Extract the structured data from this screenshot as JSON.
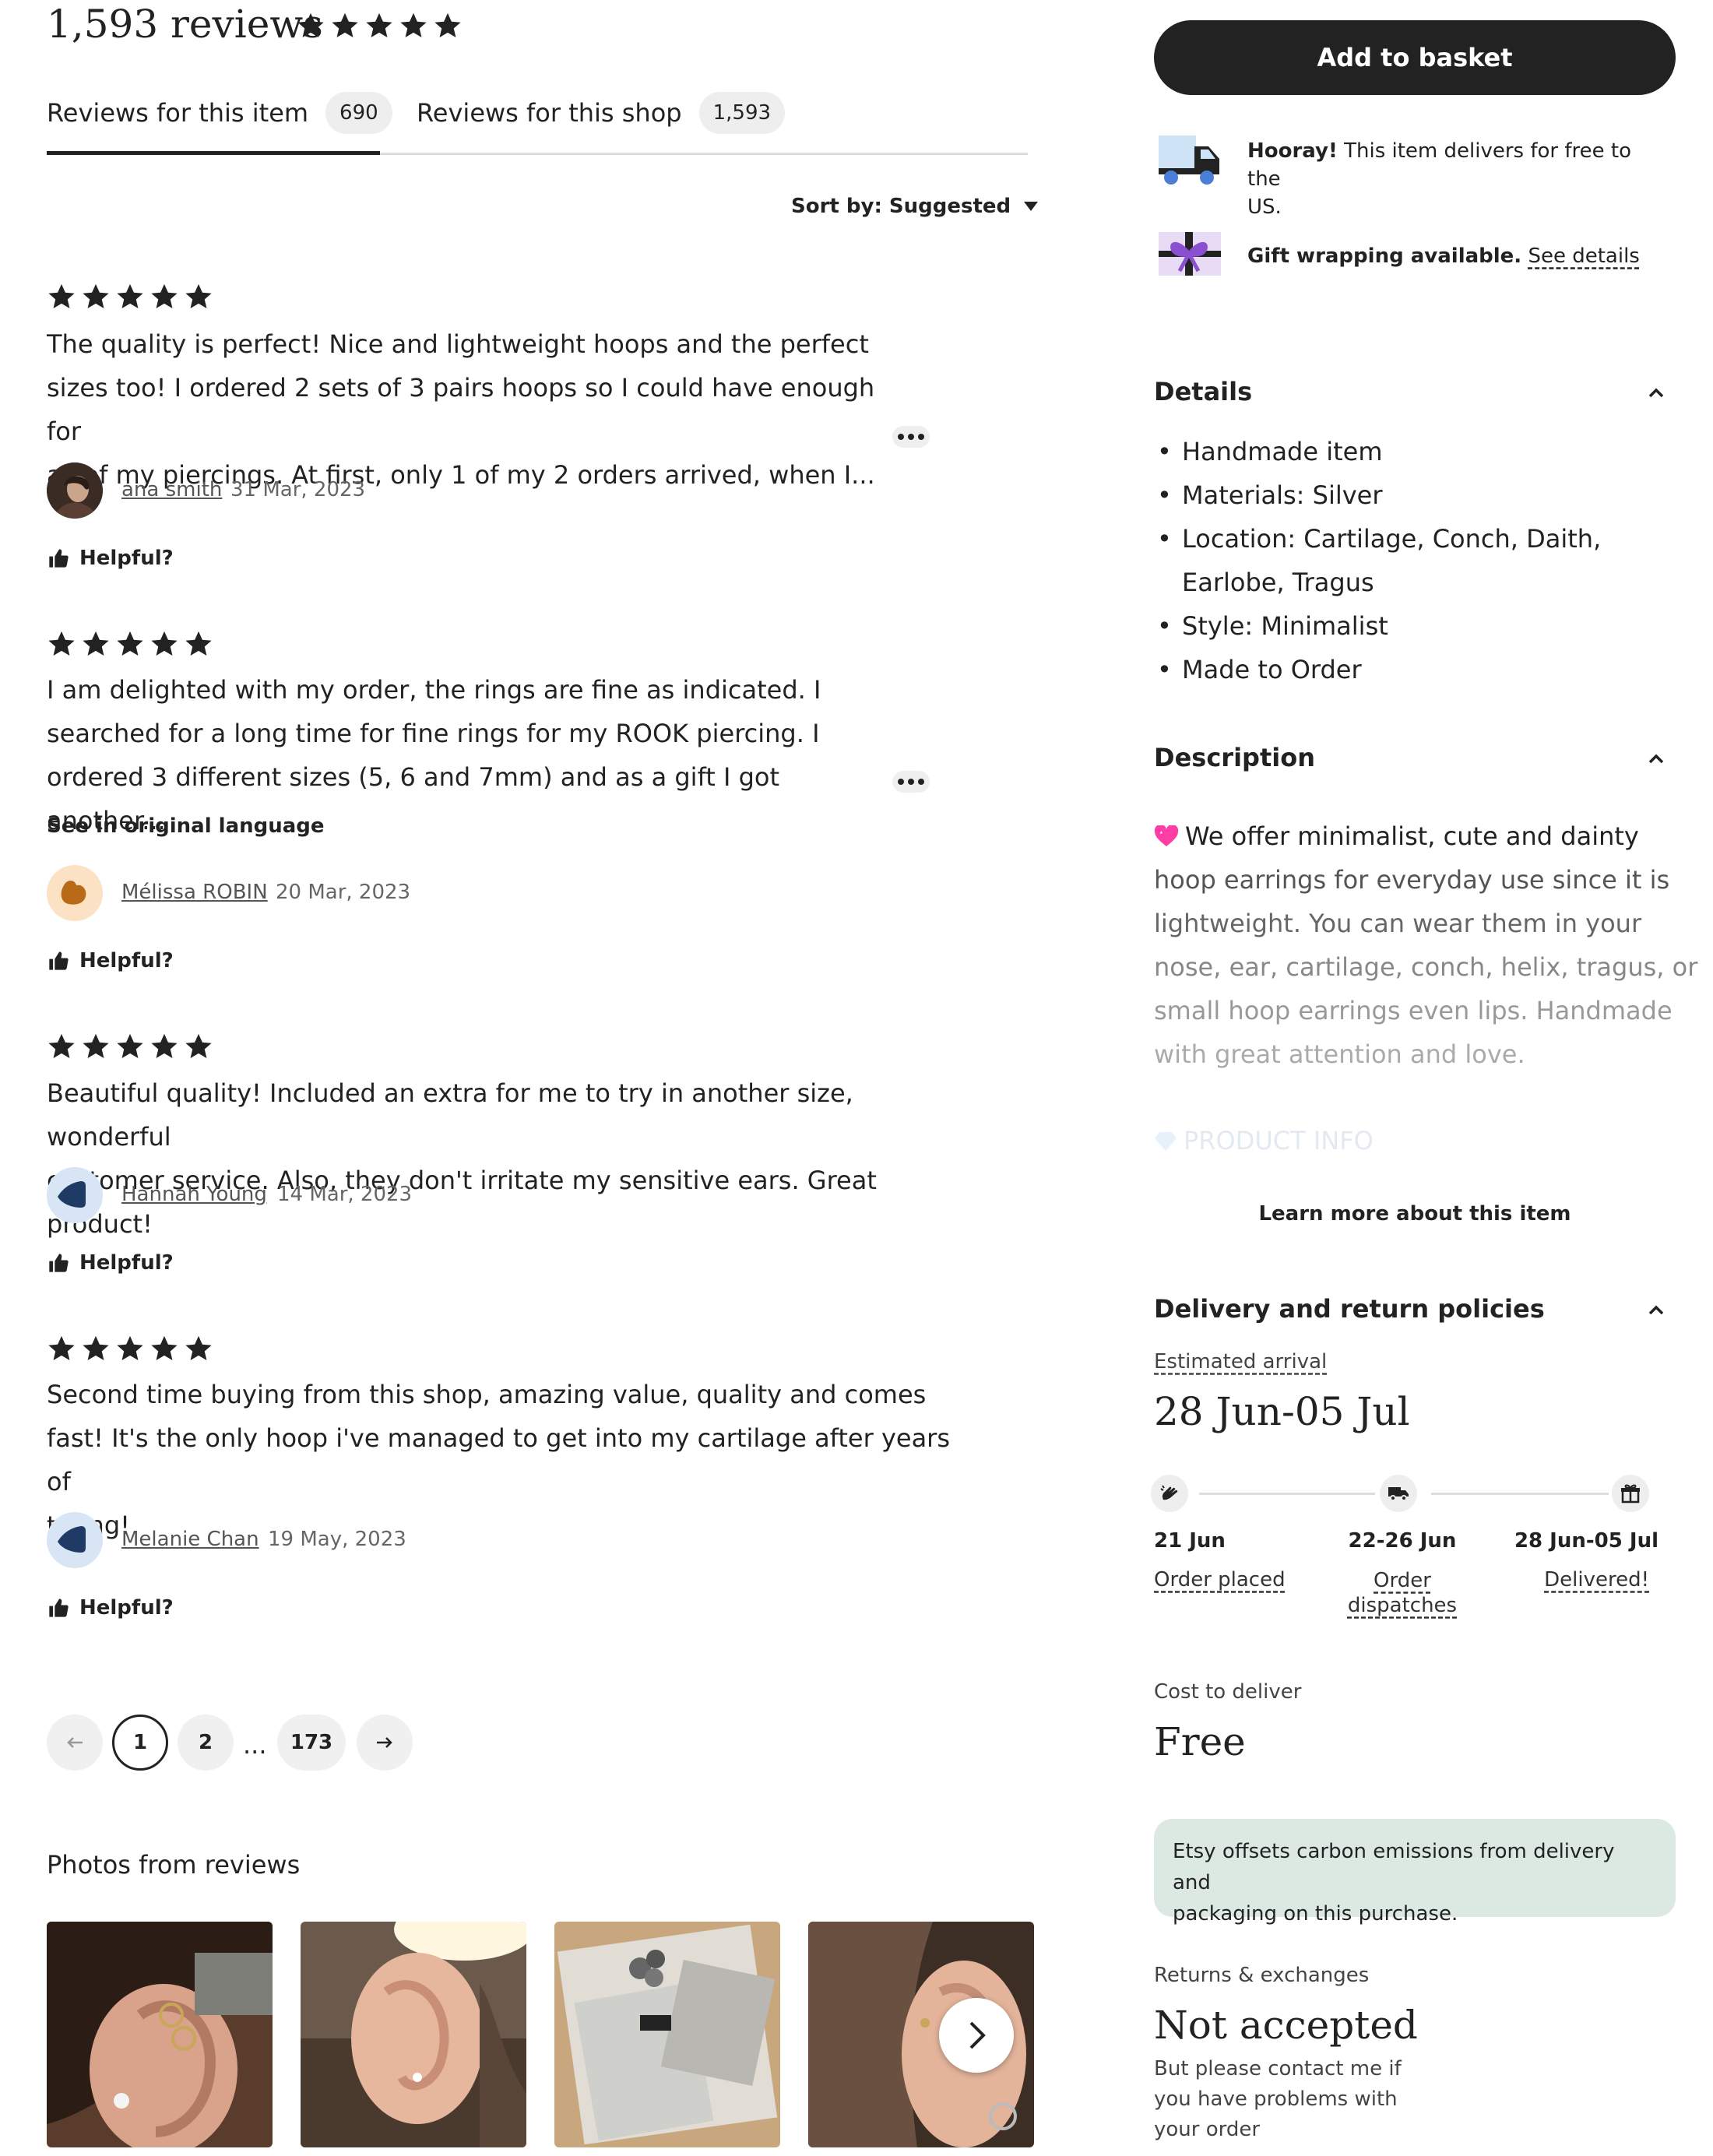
{
  "header": {
    "review_count_title": "1,593 reviews"
  },
  "tabs": [
    {
      "label": "Reviews for this item",
      "count": "690"
    },
    {
      "label": "Reviews for this shop",
      "count": "1,593"
    }
  ],
  "sort": {
    "label": "Sort by: Suggested"
  },
  "reviews": [
    {
      "rating": 5,
      "text_lines": [
        "The quality is perfect! Nice and lightweight hoops and the perfect",
        "sizes too! I ordered 2 sets of 3 pairs hoops so I could have enough for",
        "all of my piercings. At first, only 1 of my 2 orders arrived, when I..."
      ],
      "author": "ana smith",
      "date": "31 Mar, 2023",
      "helpful": "Helpful?"
    },
    {
      "rating": 5,
      "text_lines": [
        "I am delighted with my order, the rings are fine as indicated. I",
        "searched for a long time for fine rings for my ROOK piercing. I",
        "ordered 3 different sizes (5, 6 and 7mm) and as a gift I got another..."
      ],
      "see_original": "See in original language",
      "author": "Mélissa ROBIN",
      "date": "20 Mar, 2023",
      "helpful": "Helpful?"
    },
    {
      "rating": 5,
      "text_lines": [
        "Beautiful quality! Included an extra for me to try in another size, wonderful",
        "customer service. Also, they don't irritate my sensitive ears. Great product!"
      ],
      "author": "Hannah Young",
      "date": "14 Mar, 2023",
      "helpful": "Helpful?"
    },
    {
      "rating": 5,
      "text_lines": [
        "Second time buying from this shop, amazing value, quality and comes",
        "fast! It's the only hoop i've managed to get into my cartilage after years of",
        "trying!"
      ],
      "author": "Melanie Chan",
      "date": "19 May, 2023",
      "helpful": "Helpful?"
    }
  ],
  "pagination": {
    "pages": [
      "1",
      "2",
      "173"
    ],
    "ellipsis": "...",
    "current": "1"
  },
  "photos": {
    "title": "Photos from reviews"
  },
  "buy": {
    "add_to_basket": "Add to basket",
    "hooray_bold": "Hooray!",
    "hooray_text_1": " This item delivers for free to the",
    "hooray_text_2": "US.",
    "gift_text": "Gift wrapping available.",
    "gift_link": "See details"
  },
  "details": {
    "title": "Details",
    "items": [
      "Handmade item",
      "Materials: Silver",
      "Location: Cartilage, Conch, Daith,",
      "Earlobe, Tragus",
      "Style: Minimalist",
      "Made to Order"
    ]
  },
  "description": {
    "title": "Description",
    "lines": [
      "We offer minimalist, cute and dainty",
      "hoop earrings for everyday use since it is",
      "lightweight. You can wear them in your",
      "nose, ear, cartilage, conch, helix, tragus, or",
      "small hoop earrings even lips. Handmade",
      "with great attention and love."
    ],
    "product_info": "PRODUCT INFO",
    "learn_more": "Learn more about this item"
  },
  "delivery": {
    "title": "Delivery and return policies",
    "estimated_label": "Estimated arrival",
    "estimated_value": "28 Jun-05 Jul",
    "steps": [
      {
        "date": "21 Jun",
        "label": "Order placed"
      },
      {
        "date": "22-26 Jun",
        "label_1": "Order",
        "label_2": "dispatches"
      },
      {
        "date": "28 Jun-05 Jul",
        "label": "Delivered!"
      }
    ],
    "cost_label": "Cost to deliver",
    "cost_value": "Free",
    "carbon_1": "Etsy offsets carbon emissions from delivery and",
    "carbon_2": "packaging on this purchase.",
    "returns_label": "Returns & exchanges",
    "returns_value": "Not accepted",
    "returns_note_1": "But please contact me if",
    "returns_note_2": "you have problems with",
    "returns_note_3": "your order"
  },
  "colors": {
    "primary": "#222222",
    "carbon_bg": "#dce9e2",
    "gift_purple": "#8b4fd1"
  }
}
